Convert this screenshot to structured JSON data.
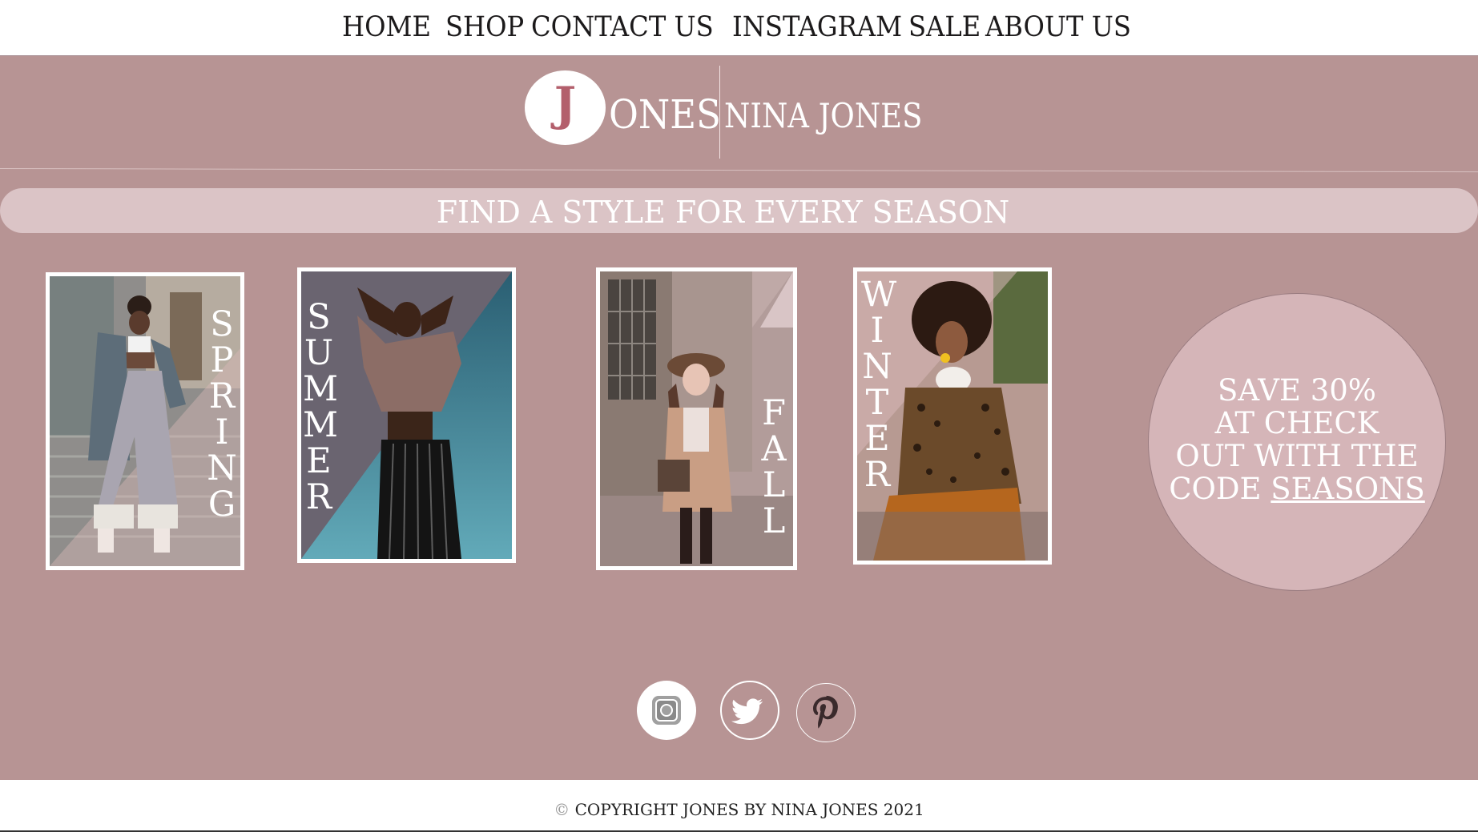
{
  "nav": {
    "items": [
      "HOME",
      "SHOP",
      "CONTACT US",
      "INSTAGRAM",
      "SALE",
      "ABOUT US"
    ]
  },
  "logo": {
    "initial": "J",
    "rest": "ONES",
    "name": "NINA JONES"
  },
  "banner": {
    "text": "FIND A STYLE FOR EVERY SEASON"
  },
  "seasons": [
    {
      "label": "SPRING",
      "letters": [
        "S",
        "P",
        "R",
        "I",
        "N",
        "G"
      ]
    },
    {
      "label": "SUMMER",
      "letters": [
        "S",
        "U",
        "M",
        "M",
        "E",
        "R"
      ]
    },
    {
      "label": "FALL",
      "letters": [
        "F",
        "A",
        "L",
        "L"
      ]
    },
    {
      "label": "WINTER",
      "letters": [
        "W",
        "I",
        "N",
        "T",
        "E",
        "R"
      ]
    }
  ],
  "promo": {
    "line1": "SAVE 30%",
    "line2": "AT CHECK",
    "line3": "OUT WITH THE",
    "line4_prefix": "CODE ",
    "code": "SEASONS"
  },
  "socials": [
    "instagram-icon",
    "twitter-icon",
    "pinterest-icon"
  ],
  "footer": {
    "symbol": "©",
    "text": "COPYRIGHT JONES BY NINA JONES 2021"
  },
  "colors": {
    "main_bg": "#b79494",
    "banner_bg": "#dbc4c6",
    "promo_bg": "#d5b5b8",
    "logo_j": "#b35f6c"
  }
}
